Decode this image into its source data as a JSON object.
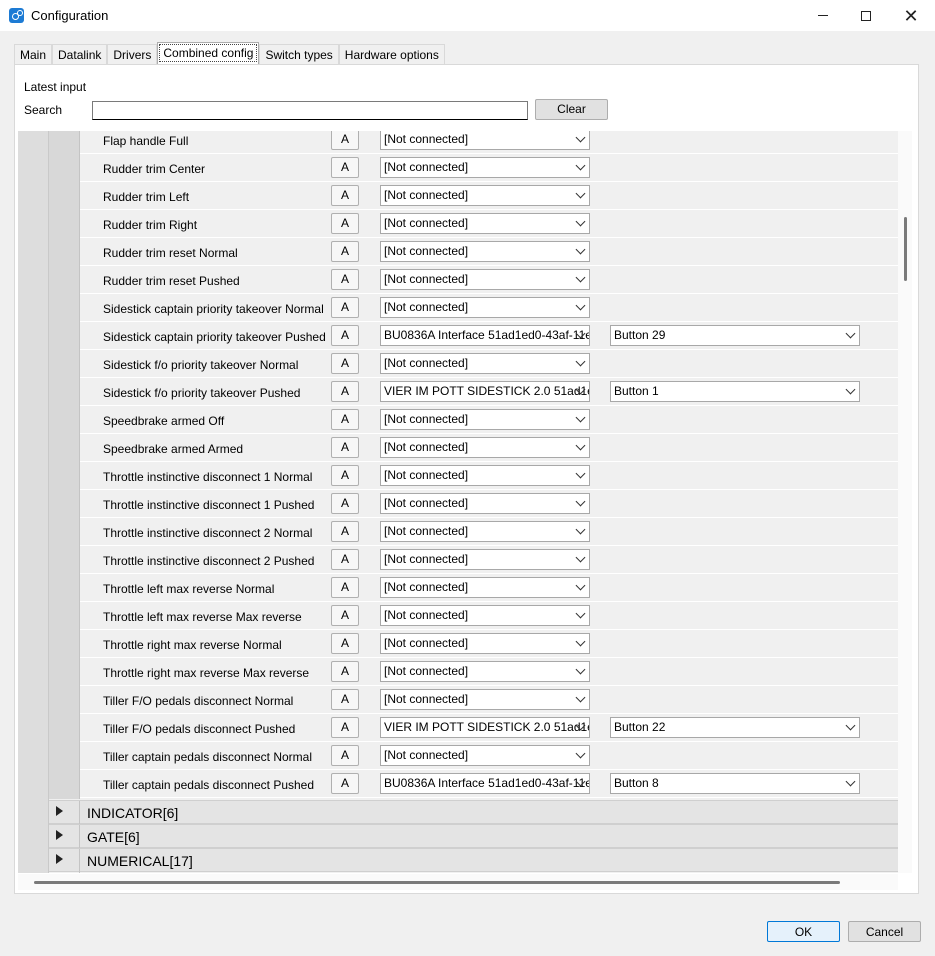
{
  "window": {
    "title": "Configuration",
    "app_icon": "configuration-app-icon"
  },
  "tabs": [
    {
      "label": "Main"
    },
    {
      "label": "Datalink"
    },
    {
      "label": "Drivers"
    },
    {
      "label": "Combined config",
      "active": true
    },
    {
      "label": "Switch types"
    },
    {
      "label": "Hardware options"
    }
  ],
  "filter": {
    "latest_input_label": "Latest input",
    "search_label": "Search",
    "search_value": "",
    "clear_label": "Clear"
  },
  "rows": [
    {
      "label": "Flap handle Full",
      "button": "A",
      "device": "[Not connected]",
      "input": ""
    },
    {
      "label": "Rudder trim Center",
      "button": "A",
      "device": "[Not connected]",
      "input": ""
    },
    {
      "label": "Rudder trim Left",
      "button": "A",
      "device": "[Not connected]",
      "input": ""
    },
    {
      "label": "Rudder trim Right",
      "button": "A",
      "device": "[Not connected]",
      "input": ""
    },
    {
      "label": "Rudder trim reset Normal",
      "button": "A",
      "device": "[Not connected]",
      "input": ""
    },
    {
      "label": "Rudder trim reset Pushed",
      "button": "A",
      "device": "[Not connected]",
      "input": ""
    },
    {
      "label": "Sidestick captain priority takeover Normal",
      "button": "A",
      "device": "[Not connected]",
      "input": ""
    },
    {
      "label": "Sidestick captain priority takeover Pushed",
      "button": "A",
      "device": "BU0836A Interface 51ad1ed0-43af-11e",
      "input": "Button 29"
    },
    {
      "label": "Sidestick f/o priority takeover Normal",
      "button": "A",
      "device": "[Not connected]",
      "input": ""
    },
    {
      "label": "Sidestick f/o priority takeover Pushed",
      "button": "A",
      "device": "VIER IM POTT SIDESTICK 2.0 51ad1e",
      "input": "Button 1"
    },
    {
      "label": "Speedbrake armed Off",
      "button": "A",
      "device": "[Not connected]",
      "input": ""
    },
    {
      "label": "Speedbrake armed Armed",
      "button": "A",
      "device": "[Not connected]",
      "input": ""
    },
    {
      "label": "Throttle instinctive disconnect 1 Normal",
      "button": "A",
      "device": "[Not connected]",
      "input": ""
    },
    {
      "label": "Throttle instinctive disconnect 1 Pushed",
      "button": "A",
      "device": "[Not connected]",
      "input": ""
    },
    {
      "label": "Throttle instinctive disconnect 2 Normal",
      "button": "A",
      "device": "[Not connected]",
      "input": ""
    },
    {
      "label": "Throttle instinctive disconnect 2 Pushed",
      "button": "A",
      "device": "[Not connected]",
      "input": ""
    },
    {
      "label": "Throttle left max reverse Normal",
      "button": "A",
      "device": "[Not connected]",
      "input": ""
    },
    {
      "label": "Throttle left max reverse Max reverse",
      "button": "A",
      "device": "[Not connected]",
      "input": ""
    },
    {
      "label": "Throttle right max reverse Normal",
      "button": "A",
      "device": "[Not connected]",
      "input": ""
    },
    {
      "label": "Throttle right max reverse Max reverse",
      "button": "A",
      "device": "[Not connected]",
      "input": ""
    },
    {
      "label": "Tiller F/O pedals disconnect Normal",
      "button": "A",
      "device": "[Not connected]",
      "input": ""
    },
    {
      "label": "Tiller F/O pedals disconnect Pushed",
      "button": "A",
      "device": "VIER IM POTT SIDESTICK 2.0 51ad1e",
      "input": "Button 22"
    },
    {
      "label": "Tiller captain pedals disconnect Normal",
      "button": "A",
      "device": "[Not connected]",
      "input": ""
    },
    {
      "label": "Tiller captain pedals disconnect Pushed",
      "button": "A",
      "device": "BU0836A Interface 51ad1ed0-43af-11e",
      "input": "Button 8"
    }
  ],
  "groups": [
    {
      "label": "INDICATOR[6]",
      "icon": "expand-arrow-icon"
    },
    {
      "label": "GATE[6]",
      "icon": "expand-arrow-icon"
    },
    {
      "label": "NUMERICAL[17]",
      "icon": "expand-arrow-icon"
    }
  ],
  "footer": {
    "ok_label": "OK",
    "cancel_label": "Cancel"
  }
}
